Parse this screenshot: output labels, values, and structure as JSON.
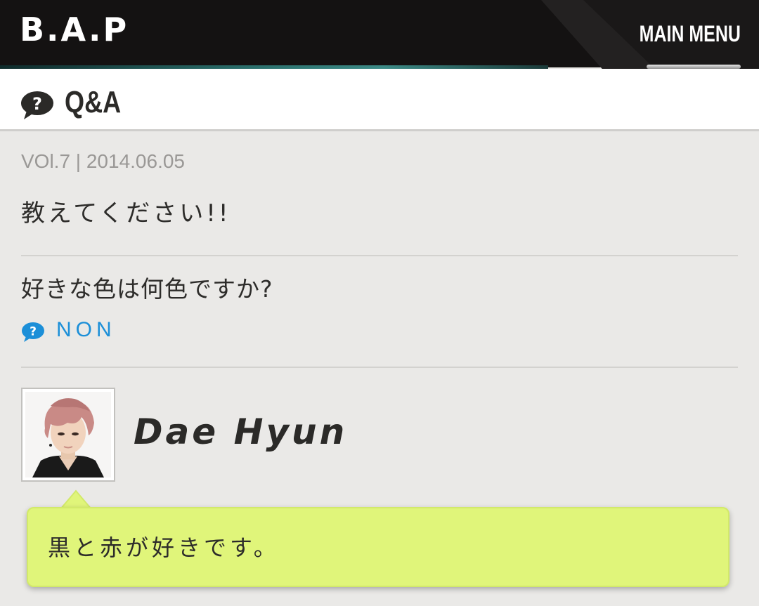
{
  "header": {
    "logo_text": "B.A.P",
    "menu_label": "MAIN MENU",
    "menu_icon": "hamburger-icon"
  },
  "title_bar": {
    "icon": "question-bubble-icon",
    "title": "Q&A"
  },
  "post": {
    "meta": "VOl.7 | 2014.06.05",
    "heading": "教えてください!!",
    "question": "好きな色は何色ですか?",
    "asker_icon": "question-bubble-icon",
    "asker_name": "NON"
  },
  "answer": {
    "member_name": "Dae Hyun",
    "avatar": "member-photo",
    "text": "黒と赤が好きです。"
  },
  "colors": {
    "header_bg": "#141212",
    "accent_teal": "#3c8a86",
    "asker_blue": "#1c8fd8",
    "bubble_green": "#e0f57a",
    "page_bg": "#eae9e7"
  }
}
